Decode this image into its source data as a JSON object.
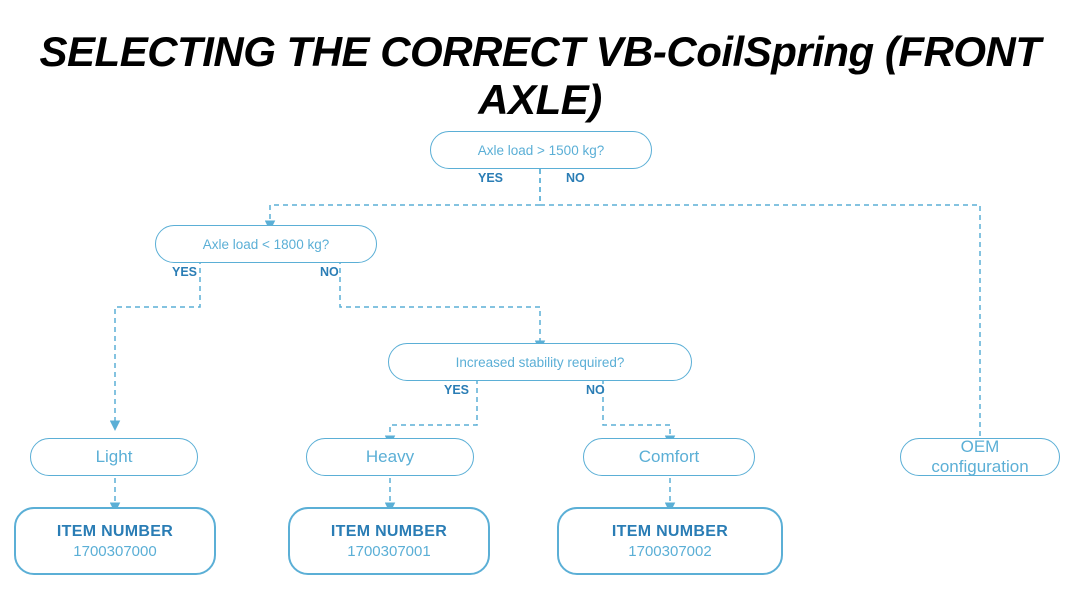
{
  "title": "SELECTING THE CORRECT VB-CoilSpring (FRONT AXLE)",
  "diagram": {
    "question1": {
      "text": "Axle load > 1500 kg?",
      "yes": "YES",
      "no": "NO"
    },
    "question2": {
      "text": "Axle load < 1800 kg?",
      "yes": "YES",
      "no": "NO"
    },
    "question3": {
      "text": "Increased stability required?",
      "yes": "YES",
      "no": "NO"
    },
    "result_light": "Light",
    "result_heavy": "Heavy",
    "result_comfort": "Comfort",
    "result_oem": "OEM configuration",
    "item1_label": "ITEM NUMBER",
    "item1_number": "1700307000",
    "item2_label": "ITEM NUMBER",
    "item2_number": "1700307001",
    "item3_label": "ITEM NUMBER",
    "item3_number": "1700307002"
  }
}
